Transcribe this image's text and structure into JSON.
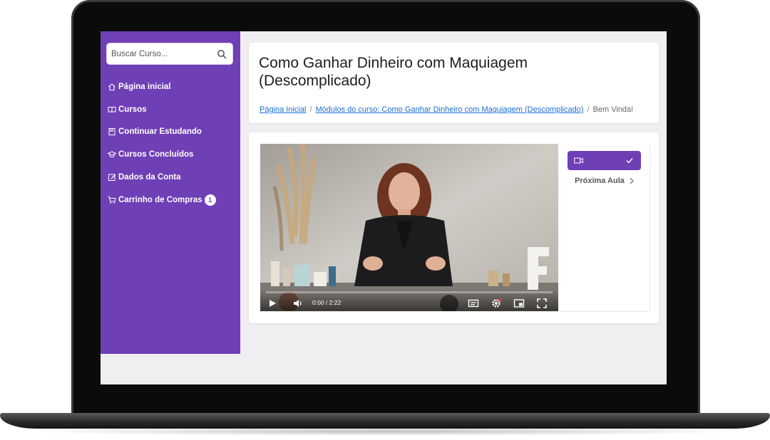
{
  "search": {
    "placeholder": "Buscar Curso..."
  },
  "sidebar": {
    "items": [
      {
        "label": "Página inicial"
      },
      {
        "label": "Cursos"
      },
      {
        "label": "Continuar Estudando"
      },
      {
        "label": "Cursos Concluídos"
      },
      {
        "label": "Dados da Conta"
      },
      {
        "label": "Carrinho de Compras",
        "badge": "1"
      }
    ]
  },
  "page": {
    "title": "Como Ganhar Dinheiro com Maquiagem (Descomplicado)"
  },
  "breadcrumb": {
    "home": "Página Inicial",
    "module": "Módulos do curso: Como Ganhar Dinheiro com Maquiagem (Descomplicado)",
    "current": "Bem Vinda!"
  },
  "video": {
    "time": "0:00 / 2:22",
    "progress": 0
  },
  "playlist": {
    "next_label": "Próxima Aula"
  },
  "colors": {
    "accent": "#6f3fb6",
    "link": "#1a6fd1"
  }
}
